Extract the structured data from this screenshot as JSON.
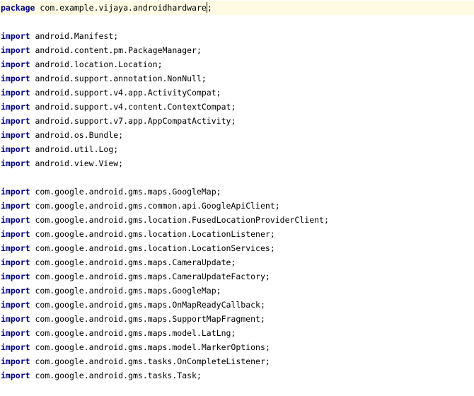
{
  "editor": {
    "lines": [
      {
        "kw": "package",
        "text": "com.example.vijaya.androidhardware",
        "end": ";",
        "caret": true
      },
      {
        "kw": "",
        "text": ""
      },
      {
        "kw": "import",
        "text": "android.Manifest;"
      },
      {
        "kw": "import",
        "text": "android.content.pm.PackageManager;"
      },
      {
        "kw": "import",
        "text": "android.location.Location;"
      },
      {
        "kw": "import",
        "text": "android.support.annotation.NonNull;"
      },
      {
        "kw": "import",
        "text": "android.support.v4.app.ActivityCompat;"
      },
      {
        "kw": "import",
        "text": "android.support.v4.content.ContextCompat;"
      },
      {
        "kw": "import",
        "text": "android.support.v7.app.AppCompatActivity;"
      },
      {
        "kw": "import",
        "text": "android.os.Bundle;"
      },
      {
        "kw": "import",
        "text": "android.util.Log;"
      },
      {
        "kw": "import",
        "text": "android.view.View;"
      },
      {
        "kw": "",
        "text": ""
      },
      {
        "kw": "import",
        "text": "com.google.android.gms.maps.GoogleMap;"
      },
      {
        "kw": "import",
        "text": "com.google.android.gms.common.api.GoogleApiClient;"
      },
      {
        "kw": "import",
        "text": "com.google.android.gms.location.FusedLocationProviderClient;"
      },
      {
        "kw": "import",
        "text": "com.google.android.gms.location.LocationListener;"
      },
      {
        "kw": "import",
        "text": "com.google.android.gms.location.LocationServices;"
      },
      {
        "kw": "import",
        "text": "com.google.android.gms.maps.CameraUpdate;"
      },
      {
        "kw": "import",
        "text": "com.google.android.gms.maps.CameraUpdateFactory;"
      },
      {
        "kw": "import",
        "text": "com.google.android.gms.maps.GoogleMap;"
      },
      {
        "kw": "import",
        "text": "com.google.android.gms.maps.OnMapReadyCallback;"
      },
      {
        "kw": "import",
        "text": "com.google.android.gms.maps.SupportMapFragment;"
      },
      {
        "kw": "import",
        "text": "com.google.android.gms.maps.model.LatLng;"
      },
      {
        "kw": "import",
        "text": "com.google.android.gms.maps.model.MarkerOptions;"
      },
      {
        "kw": "import",
        "text": "com.google.android.gms.tasks.OnCompleteListener;"
      },
      {
        "kw": "import",
        "text": "com.google.android.gms.tasks.Task;"
      }
    ]
  },
  "colors": {
    "keyword": "#000080",
    "text": "#000000",
    "current_line": "#fffae3",
    "background": "#ffffff"
  }
}
